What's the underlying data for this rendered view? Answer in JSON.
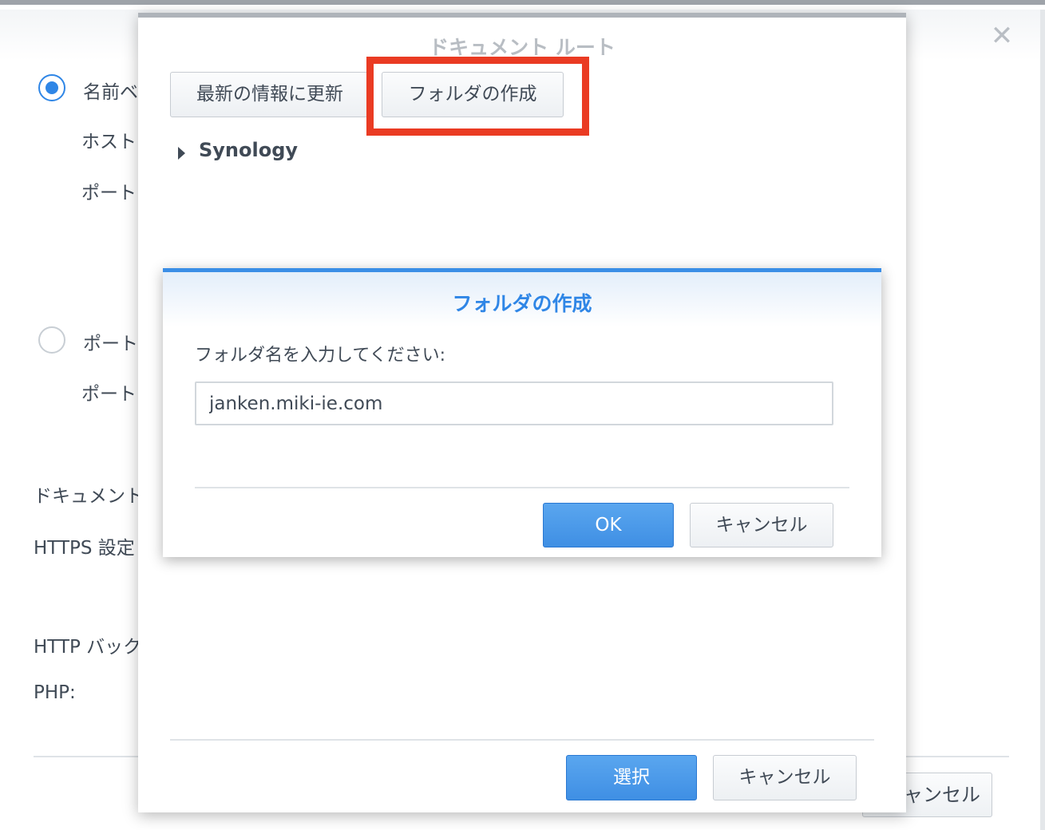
{
  "background": {
    "close_glyph": "✕",
    "radio_name_based_label": "名前ベ",
    "host_label": "ホスト",
    "port_label_1": "ポート",
    "radio_port_based_label": "ポート",
    "port_label_2": "ポート",
    "document_root_label": "ドキュメント",
    "https_label": "HTTPS 設定",
    "http_backend_label": "HTTP バック",
    "php_label": "PHP:",
    "cancel_label": "キャンセル"
  },
  "doc_dialog": {
    "title": "ドキュメント ルート",
    "refresh_label": "最新の情報に更新",
    "create_folder_label": "フォルダの作成",
    "tree_root": "Synology",
    "select_label": "選択",
    "cancel_label": "キャンセル"
  },
  "folder_modal": {
    "title": "フォルダの作成",
    "prompt": "フォルダ名を入力してください:",
    "folder_name_value": "janken.miki-ie.com",
    "ok_label": "OK",
    "cancel_label": "キャンセル"
  },
  "colors": {
    "accent": "#2f86e6",
    "highlight": "#ea3b23"
  }
}
